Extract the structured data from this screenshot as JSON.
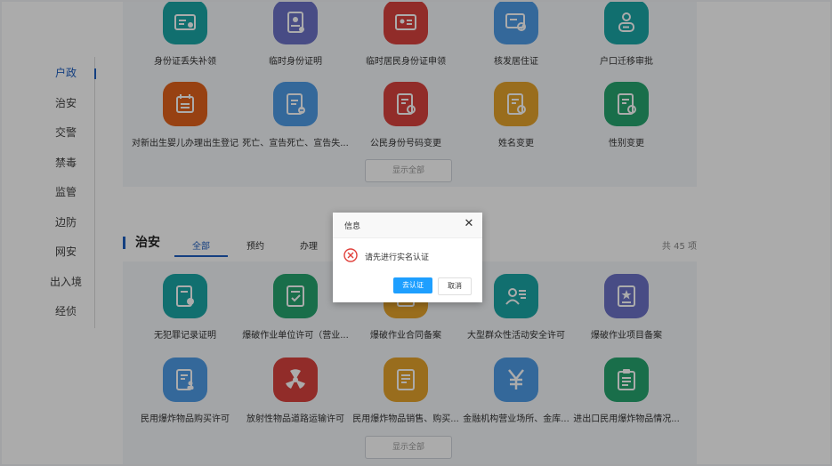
{
  "sidebar": {
    "items": [
      {
        "label": "户政",
        "active": true
      },
      {
        "label": "治安",
        "active": false
      },
      {
        "label": "交警",
        "active": false
      },
      {
        "label": "禁毒",
        "active": false
      },
      {
        "label": "监管",
        "active": false
      },
      {
        "label": "边防",
        "active": false
      },
      {
        "label": "网安",
        "active": false
      },
      {
        "label": "出入境",
        "active": false
      },
      {
        "label": "经侦",
        "active": false
      }
    ]
  },
  "huzheng": {
    "services": [
      {
        "label": "身份证丢失补领",
        "color": "#1aa6a6",
        "icon": "id-card-icon"
      },
      {
        "label": "临时身份证明",
        "color": "#6c72c7",
        "icon": "id-document-icon"
      },
      {
        "label": "临时居民身份证申领",
        "color": "#d9423e",
        "icon": "resident-card-icon"
      },
      {
        "label": "核发居住证",
        "color": "#4e9be6",
        "icon": "residence-permit-icon"
      },
      {
        "label": "户口迁移审批",
        "color": "#1aa6a6",
        "icon": "person-transfer-icon"
      },
      {
        "label": "对新出生婴儿办理出生登记",
        "color": "#e2621b",
        "icon": "calendar-icon"
      },
      {
        "label": "死亡、宣告死亡、宣告失...",
        "color": "#4e9be6",
        "icon": "document-minus-icon"
      },
      {
        "label": "公民身份号码变更",
        "color": "#d9423e",
        "icon": "document-refresh-icon"
      },
      {
        "label": "姓名变更",
        "color": "#e5a32c",
        "icon": "document-refresh-icon"
      },
      {
        "label": "性别变更",
        "color": "#26a56f",
        "icon": "document-refresh-icon"
      }
    ],
    "show_all": "显示全部"
  },
  "zhian": {
    "title": "治安",
    "tabs": [
      {
        "label": "全部",
        "active": true
      },
      {
        "label": "预约",
        "active": false
      },
      {
        "label": "办理",
        "active": false
      }
    ],
    "count": "共 45 项",
    "services": [
      {
        "label": "无犯罪记录证明",
        "color": "#1aa6a6",
        "icon": "certificate-icon"
      },
      {
        "label": "爆破作业单位许可（营业...",
        "color": "#26a56f",
        "icon": "document-check-icon"
      },
      {
        "label": "爆破作业合同备案",
        "color": "#e5a32c",
        "icon": "contract-icon"
      },
      {
        "label": "大型群众性活动安全许可",
        "color": "#1aa6a6",
        "icon": "person-list-icon"
      },
      {
        "label": "爆破作业项目备案",
        "color": "#6c72c7",
        "icon": "star-document-icon"
      },
      {
        "label": "民用爆炸物品购买许可",
        "color": "#4e9be6",
        "icon": "document-person-icon"
      },
      {
        "label": "放射性物品道路运输许可",
        "color": "#d9423e",
        "icon": "radiation-icon"
      },
      {
        "label": "民用爆炸物品销售、购买...",
        "color": "#e5a32c",
        "icon": "document-edit-icon"
      },
      {
        "label": "金融机构营业场所、金库...",
        "color": "#4e9be6",
        "icon": "yen-icon"
      },
      {
        "label": "进出口民用爆炸物品情况...",
        "color": "#26a56f",
        "icon": "clipboard-icon"
      }
    ],
    "show_all": "显示全部"
  },
  "dialog": {
    "title": "信息",
    "message": "请先进行实名认证",
    "confirm_label": "去认证",
    "cancel_label": "取消",
    "close_glyph": "✕",
    "error_color": "#e0403b"
  }
}
